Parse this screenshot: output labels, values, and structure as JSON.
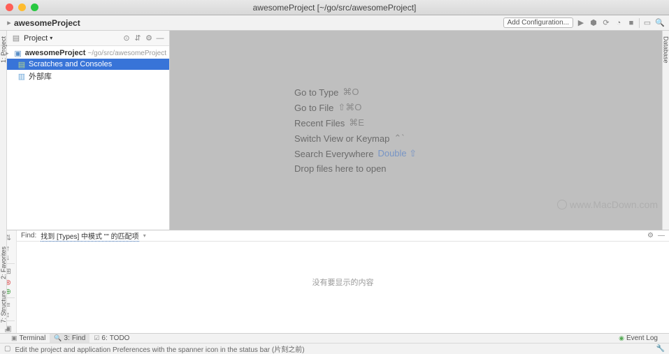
{
  "window": {
    "title": "awesomeProject [~/go/src/awesomeProject]"
  },
  "toolbar": {
    "breadcrumb": "awesomeProject",
    "add_config": "Add Configuration..."
  },
  "sidebar": {
    "title": "Project",
    "items": [
      {
        "name": "awesomeProject",
        "path": "~/go/src/awesomeProject"
      },
      {
        "name": "Scratches and Consoles"
      },
      {
        "name": "外部库"
      }
    ]
  },
  "editor_hints": [
    {
      "label": "Go to Type",
      "kbd": "⌘O"
    },
    {
      "label": "Go to File",
      "kbd": "⇧⌘O"
    },
    {
      "label": "Recent Files",
      "kbd": "⌘E"
    },
    {
      "label": "Switch View or Keymap",
      "kbd": "⌃`"
    },
    {
      "label": "Search Everywhere",
      "kbd": "Double ⇧",
      "blue": true
    },
    {
      "label": "Drop files here to open",
      "kbd": ""
    }
  ],
  "watermark": "www.MacDown.com",
  "find": {
    "label": "Find:",
    "desc": "找到 [Types] 中模式 \"\" 的匹配项",
    "empty": "没有要显示的内容"
  },
  "bottom_tabs": {
    "terminal": "Terminal",
    "find_num": "3:",
    "find": "Find",
    "todo_num": "6:",
    "todo": "TODO",
    "event_log": "Event Log"
  },
  "left_gutters": {
    "project_num": "1:",
    "project": "Project"
  },
  "right_gutters": {
    "database": "Database"
  },
  "structure_gutter": {
    "fav_num": "2:",
    "fav": "Favorites",
    "struct_num": "7:",
    "struct": "Structure"
  },
  "status": {
    "hint": "Edit the project and application Preferences with the spanner icon in the status bar (片刻之前)"
  }
}
